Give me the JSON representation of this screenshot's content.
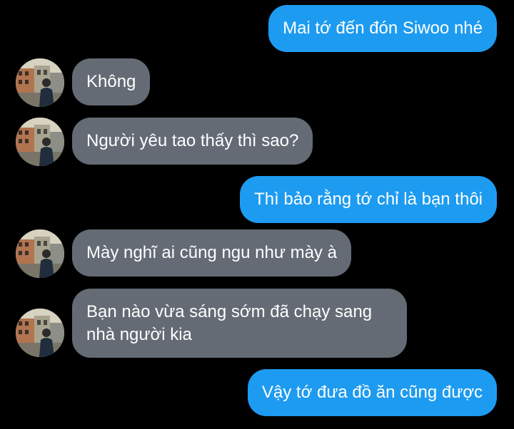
{
  "contact": {
    "avatar_icon": "contact-avatar-icon"
  },
  "colors": {
    "background": "#000000",
    "outgoing_bubble": "#1d9bf0",
    "incoming_bubble": "#646b75",
    "text": "#ffffff"
  },
  "messages": [
    {
      "direction": "outgoing",
      "text": "Mai tớ đến đón Siwoo nhé"
    },
    {
      "direction": "incoming",
      "text": "Không"
    },
    {
      "direction": "incoming",
      "text": "Người yêu tao thấy thì sao?"
    },
    {
      "direction": "outgoing",
      "text": "Thì bảo rằng tớ chỉ là bạn thôi"
    },
    {
      "direction": "incoming",
      "text": "Mày nghĩ ai cũng ngu như mày à"
    },
    {
      "direction": "incoming",
      "text": "Bạn nào vừa sáng sớm đã chạy sang nhà người kia"
    },
    {
      "direction": "outgoing",
      "text": "Vậy tớ đưa đồ ăn cũng được"
    }
  ]
}
